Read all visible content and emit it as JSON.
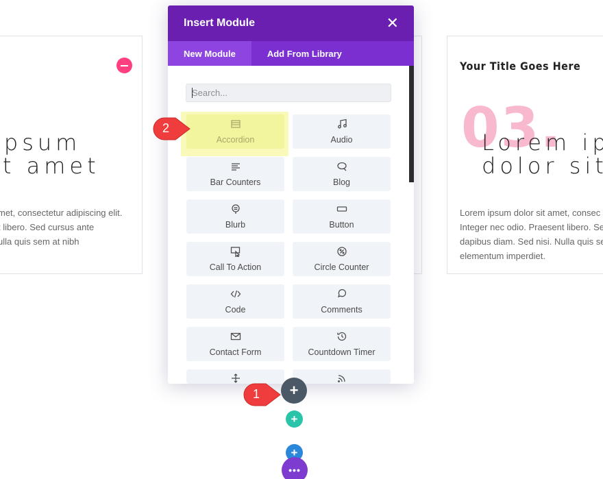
{
  "left_card": {
    "heading_lines": [
      "ipsum",
      "it amet"
    ],
    "body_lines": [
      "met, consectetur adipiscing elit.",
      "t libero. Sed cursus ante",
      "ulla quis sem at nibh"
    ],
    "remove_button_label": "—"
  },
  "right_card": {
    "title": "Your Title Goes Here",
    "number": "03.",
    "heading_lines": [
      "Lorem ipsu",
      "dolor sit a"
    ],
    "body_lines": [
      "Lorem ipsum dolor sit amet, consec",
      "Integer nec odio. Praesent libero. Se",
      "dapibus diam. Sed nisi. Nulla quis se",
      "elementum imperdiet."
    ]
  },
  "modal": {
    "title": "Insert Module",
    "close_label": "✕",
    "tabs": [
      {
        "label": "New Module",
        "active": true
      },
      {
        "label": "Add From Library",
        "active": false
      }
    ],
    "search_placeholder": "Search...",
    "modules": [
      {
        "label": "Accordion",
        "icon": "accordion-icon"
      },
      {
        "label": "Audio",
        "icon": "music-note-icon"
      },
      {
        "label": "Bar Counters",
        "icon": "bar-counters-icon"
      },
      {
        "label": "Blog",
        "icon": "chat-bubble-icon"
      },
      {
        "label": "Blurb",
        "icon": "blurb-icon"
      },
      {
        "label": "Button",
        "icon": "button-icon"
      },
      {
        "label": "Call To Action",
        "icon": "call-to-action-icon"
      },
      {
        "label": "Circle Counter",
        "icon": "circle-counter-icon"
      },
      {
        "label": "Code",
        "icon": "code-icon"
      },
      {
        "label": "Comments",
        "icon": "comments-icon"
      },
      {
        "label": "Contact Form",
        "icon": "envelope-icon"
      },
      {
        "label": "Countdown Timer",
        "icon": "countdown-timer-icon"
      },
      {
        "label": "",
        "icon": "divider-icon"
      },
      {
        "label": "",
        "icon": "rss-icon"
      }
    ],
    "highlight_color": "#f4f682"
  },
  "callouts": {
    "one": "1",
    "two": "2"
  },
  "controls": {
    "add_module": "+",
    "add_row": "+",
    "add_section": "+",
    "more": "•••"
  },
  "colors": {
    "modal_header": "#6a1fb0",
    "tab_bar": "#7b2fd0",
    "pink": "#ff3f7f",
    "green": "#29c4a9",
    "blue": "#2b87da",
    "purple": "#7e3bd0",
    "callout": "#ef3c3c"
  }
}
